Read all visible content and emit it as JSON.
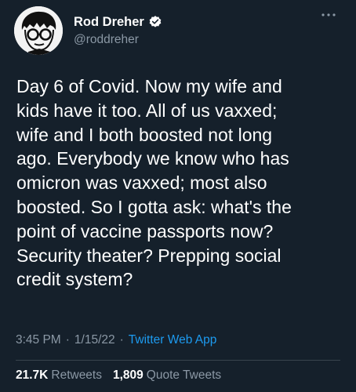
{
  "author": {
    "display_name": "Rod Dreher",
    "handle": "@roddreher",
    "verified": true
  },
  "tweet": {
    "text": "Day 6 of Covid. Now my wife and\nkids have it too. All of us vaxxed;\nwife and I both boosted not long\nago. Everybody we know who has\nomicron was vaxxed; most also\nboosted. So I gotta ask: what's the\npoint of vaccine passports now?\nSecurity theater? Prepping social\ncredit system?",
    "time": "3:45 PM",
    "date": "1/15/22",
    "separator": "·",
    "source_app": "Twitter Web App"
  },
  "stats": {
    "retweets_count": "21.7K",
    "retweets_label": "Retweets",
    "quotes_count": "1,809",
    "quotes_label": "Quote Tweets"
  },
  "icons": {
    "verified": "verified-badge-icon",
    "more": "more-options-icon"
  },
  "colors": {
    "background": "#15202b",
    "text": "#ffffff",
    "secondary": "#8b98a5",
    "link": "#1d9bf0",
    "divider": "#38444d"
  }
}
